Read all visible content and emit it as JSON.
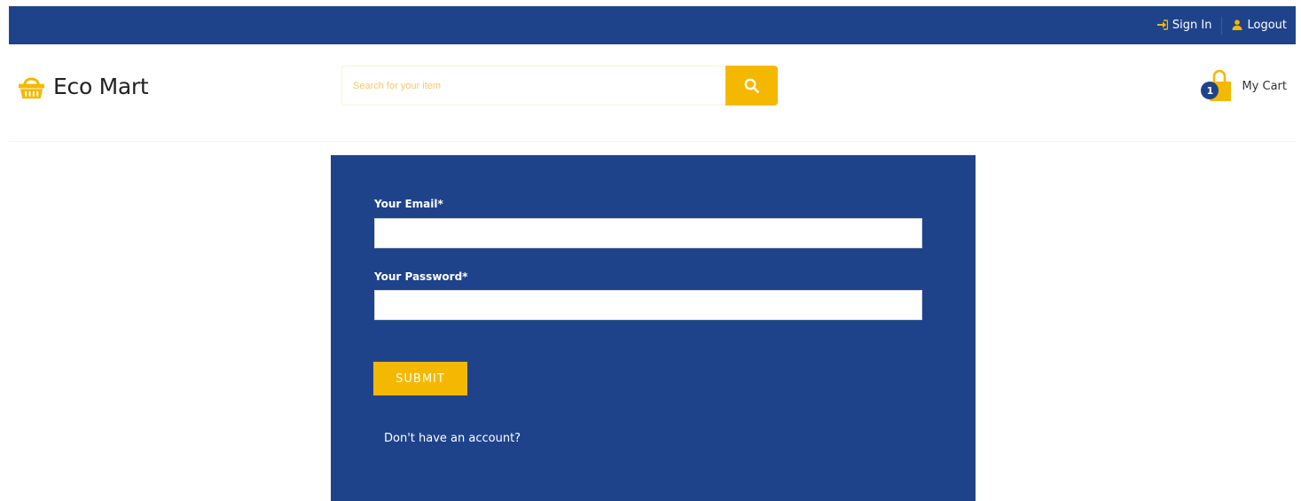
{
  "topbar": {
    "sign_in": "Sign In",
    "logout": "Logout"
  },
  "header": {
    "brand": "Eco Mart",
    "search_placeholder": "Search for your item",
    "cart_count": "1",
    "cart_label": "My Cart"
  },
  "login_form": {
    "email_label": "Your Email*",
    "email_value": "",
    "password_label": "Your Password*",
    "password_value": "",
    "submit_label": "SUBMIT",
    "signup_link": "Don't have an account?"
  },
  "colors": {
    "primary": "#1f438b",
    "accent": "#f5b800"
  },
  "icons": {
    "sign_in": "sign-in-icon",
    "logout": "user-icon",
    "logo": "basket-icon",
    "search": "search-icon",
    "cart": "shopping-bag-icon"
  }
}
